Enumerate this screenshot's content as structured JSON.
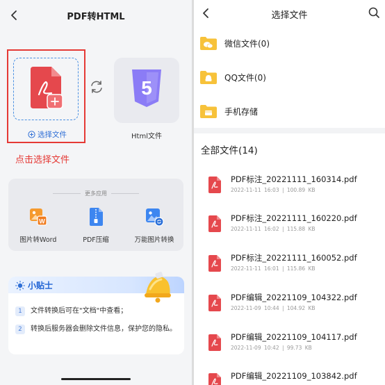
{
  "left_screen": {
    "title": "PDF转HTML",
    "select_label": "选择文件",
    "annotation": "点击选择文件",
    "target_label": "Html文件",
    "target_icon_glyph": "5",
    "more_apps": {
      "title": "更多应用",
      "items": [
        {
          "label": "图片转Word",
          "icon": "image-to-word-icon"
        },
        {
          "label": "PDF压缩",
          "icon": "pdf-compress-icon"
        },
        {
          "label": "万能图片转换",
          "icon": "image-convert-icon"
        }
      ]
    },
    "tips": {
      "title": "小贴士",
      "items": [
        {
          "num": "1",
          "text": "文件转换后可在\"文档\"中查看；"
        },
        {
          "num": "2",
          "text": "转换后服务器会删除文件信息，保护您的隐私。"
        }
      ]
    }
  },
  "right_screen": {
    "title": "选择文件",
    "folders": [
      {
        "label": "微信文件(0)",
        "icon": "wechat-folder-icon"
      },
      {
        "label": "QQ文件(0)",
        "icon": "qq-folder-icon"
      },
      {
        "label": "手机存储",
        "icon": "phone-storage-folder-icon"
      }
    ],
    "all_files_title": "全部文件(14)",
    "files": [
      {
        "name": "PDF标注_20221111_160314.pdf",
        "meta": "2022-11-11 16:03 | 100.89 KB"
      },
      {
        "name": "PDF标注_20221111_160220.pdf",
        "meta": "2022-11-11 16:02 | 115.88 KB"
      },
      {
        "name": "PDF标注_20221111_160052.pdf",
        "meta": "2022-11-11 16:01 | 115.86 KB"
      },
      {
        "name": "PDF编辑_20221109_104322.pdf",
        "meta": "2022-11-09 10:44 | 104.92 KB"
      },
      {
        "name": "PDF编辑_20221109_104117.pdf",
        "meta": "2022-11-09 10:42 | 99.73 KB"
      },
      {
        "name": "PDF编辑_20221109_103842.pdf",
        "meta": ""
      }
    ]
  },
  "colors": {
    "accent_blue": "#2f6fd6",
    "annotation_red": "#e53935",
    "pdf_red": "#e5484d",
    "html_purple": "#8b7cf6",
    "folder_yellow": "#f7c23a"
  }
}
